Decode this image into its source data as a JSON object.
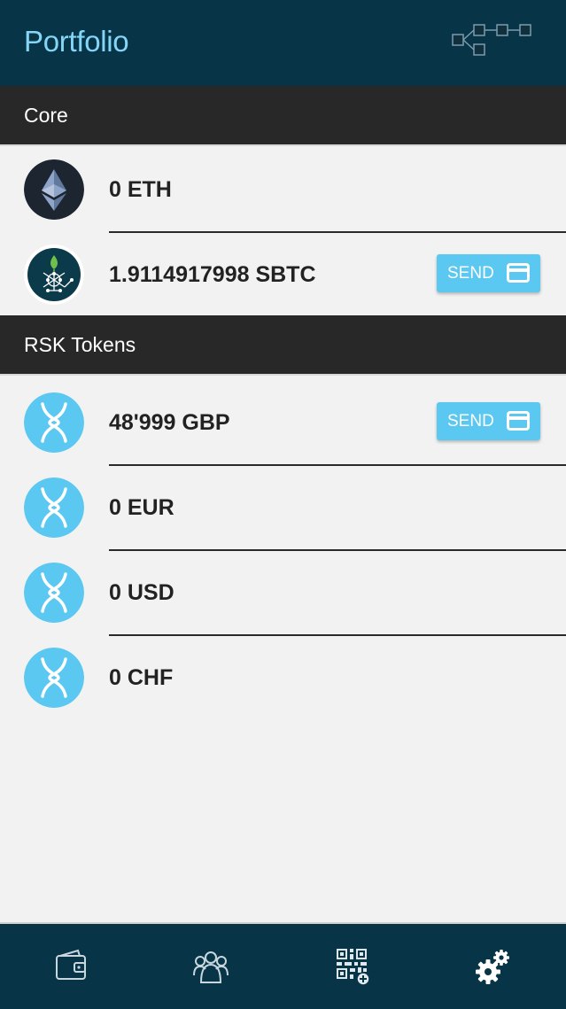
{
  "header": {
    "title": "Portfolio",
    "network_icon": "network-nodes-icon"
  },
  "sections": [
    {
      "title": "Core"
    },
    {
      "title": "RSK Tokens"
    }
  ],
  "core_items": [
    {
      "amount": "0 ETH",
      "logo": "ethereum-logo"
    },
    {
      "amount": "1.9114917998 SBTC",
      "logo": "rsk-logo",
      "send_label": "SEND"
    }
  ],
  "token_items": [
    {
      "amount": "48'999 GBP",
      "logo": "rif-token-logo",
      "send_label": "SEND"
    },
    {
      "amount": "0 EUR",
      "logo": "rif-token-logo"
    },
    {
      "amount": "0 USD",
      "logo": "rif-token-logo"
    },
    {
      "amount": "0 CHF",
      "logo": "rif-token-logo"
    }
  ],
  "bottom_nav": [
    {
      "icon": "wallet-icon"
    },
    {
      "icon": "contacts-icon"
    },
    {
      "icon": "qr-code-add-icon"
    },
    {
      "icon": "settings-gears-icon"
    }
  ],
  "colors": {
    "header_bg": "#083447",
    "title": "#84d6f7",
    "section_bg": "#282828",
    "send_button": "#5bc8f2",
    "token_logo": "#5bc8f2"
  }
}
